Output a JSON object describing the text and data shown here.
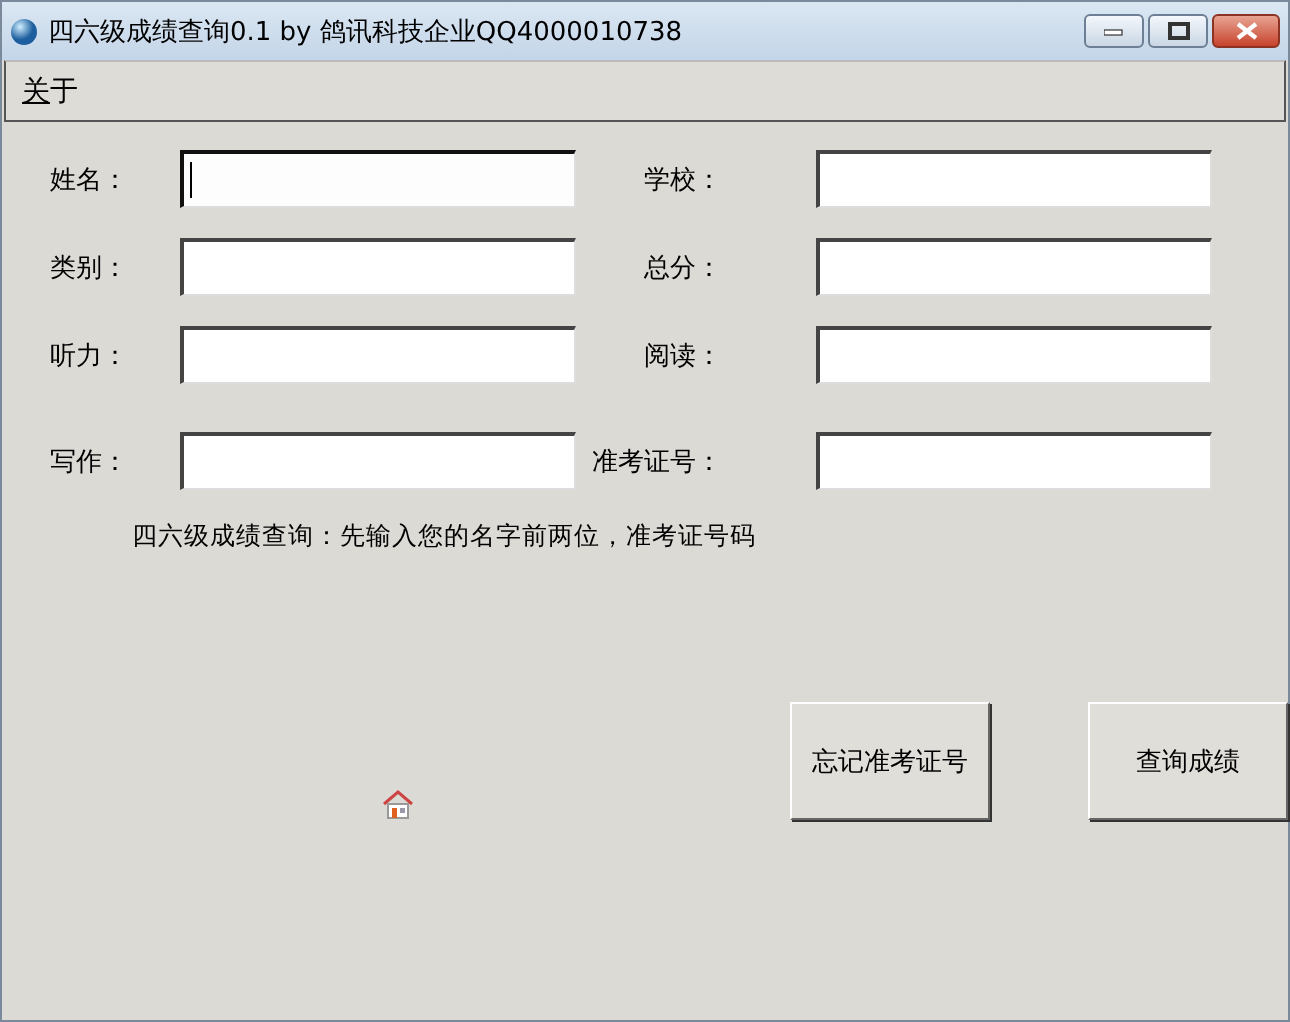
{
  "window": {
    "title": "四六级成绩查询0.1 by 鸽讯科技企业QQ4000010738"
  },
  "menu": [
    {
      "label": "关于"
    }
  ],
  "fields": [
    {
      "label": "姓名：",
      "focused": true
    },
    {
      "label": "学校：",
      "focused": false
    },
    {
      "label": "类别：",
      "focused": false
    },
    {
      "label": "总分：",
      "focused": false
    },
    {
      "label": "听力：",
      "focused": false
    },
    {
      "label": "阅读：",
      "focused": false
    },
    {
      "label": "写作：",
      "focused": false
    },
    {
      "label": "准考证号：",
      "focused": false
    }
  ],
  "hint": "四六级成绩查询：先输入您的名字前两位，准考证号码",
  "buttons": [
    "忘记准考证号",
    "查询成绩"
  ]
}
